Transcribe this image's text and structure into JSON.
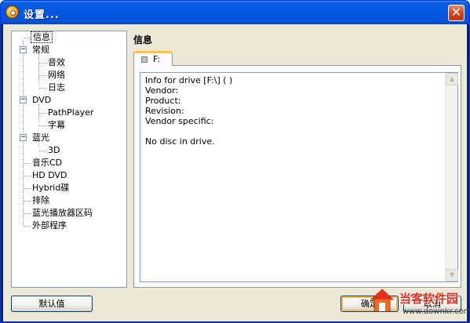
{
  "window": {
    "title": "设置...",
    "close_glyph": "✕",
    "app_icon": "disc-icon"
  },
  "tree": {
    "items": [
      {
        "label": "信息",
        "selected": true
      },
      {
        "label": "常规",
        "expander": "−"
      },
      {
        "label": "音效"
      },
      {
        "label": "网络"
      },
      {
        "label": "日志"
      },
      {
        "label": "DVD",
        "expander": "−"
      },
      {
        "label": "PathPlayer"
      },
      {
        "label": "字幕"
      },
      {
        "label": "蓝光",
        "expander": "−"
      },
      {
        "label": "3D"
      },
      {
        "label": "音乐CD"
      },
      {
        "label": "HD DVD"
      },
      {
        "label": "Hybrid碟"
      },
      {
        "label": "排除"
      },
      {
        "label": "蓝光播放器区码"
      },
      {
        "label": "外部程序"
      }
    ]
  },
  "main": {
    "section_title": "信息",
    "tab_label": "F:",
    "info_lines": [
      "Info for drive [F:\\] ( )",
      "Vendor:",
      "Product:",
      "Revision:",
      "Vendor specific:",
      "",
      "No disc in drive."
    ]
  },
  "buttons": {
    "default_label": "默认值",
    "ok_label": "确定",
    "cancel_label": "取消"
  },
  "watermark": {
    "text": "当客软件园",
    "url": "www.downkr.com"
  },
  "colors": {
    "titlebar": "#0458e3",
    "close_button": "#d2451d",
    "dialog_bg": "#ece9d8",
    "tab_accent": "#ffc83c",
    "watermark_red": "#e0301e"
  }
}
